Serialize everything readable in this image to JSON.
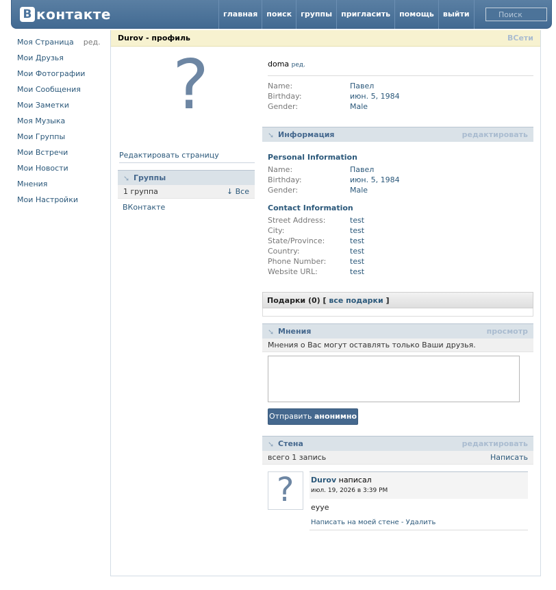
{
  "header": {
    "logo_letter": "В",
    "logo_text": "контакте",
    "nav": [
      "главная",
      "поиск",
      "группы",
      "пригласить",
      "помощь",
      "выйти"
    ],
    "search_placeholder": "Поиск"
  },
  "sidebar": {
    "items": [
      {
        "label": "Моя Страница",
        "extra": "ред."
      },
      {
        "label": "Мои Друзья"
      },
      {
        "label": "Мои Фотографии"
      },
      {
        "label": "Мои Сообщения"
      },
      {
        "label": "Мои Заметки"
      },
      {
        "label": "Моя Музыка"
      },
      {
        "label": "Мои Группы"
      },
      {
        "label": "Мои Встречи"
      },
      {
        "label": "Мои Новости"
      },
      {
        "label": "Мнения"
      },
      {
        "label": "Мои Настройки"
      }
    ]
  },
  "profile": {
    "title": "Durov - профиль",
    "all_link": "ВСети",
    "avatar_placeholder": "?",
    "edit_page": "Редактировать страницу",
    "status_text": "doma",
    "status_edit": "ред.",
    "basic": [
      {
        "k": "Name:",
        "v": "Павел"
      },
      {
        "k": "Birthday:",
        "v": "июн. 5, 1984"
      },
      {
        "k": "Gender:",
        "v": "Male"
      }
    ]
  },
  "groups": {
    "header": "Группы",
    "count": "1 группа",
    "all": "↓ Все",
    "items": [
      "ВКонтакте"
    ]
  },
  "info": {
    "header": "Информация",
    "edit": "редактировать",
    "personal_title": "Personal Information",
    "personal": [
      {
        "k": "Name:",
        "v": "Павел"
      },
      {
        "k": "Birthday:",
        "v": "июн. 5, 1984"
      },
      {
        "k": "Gender:",
        "v": "Male"
      }
    ],
    "contact_title": "Contact Information",
    "contact": [
      {
        "k": "Street Address:",
        "v": "test"
      },
      {
        "k": "City:",
        "v": "test"
      },
      {
        "k": "State/Province:",
        "v": "test"
      },
      {
        "k": "Country:",
        "v": "test"
      },
      {
        "k": "Phone Number:",
        "v": "test"
      },
      {
        "k": "Website URL:",
        "v": "test"
      }
    ]
  },
  "gifts": {
    "label": "Подарки (0)",
    "bracket_open": "[",
    "link": "все подарки",
    "bracket_close": "]"
  },
  "opinions": {
    "header": "Мнения",
    "view": "просмотр",
    "note": "Мнения о Вас могут оставлять только Ваши друзья.",
    "textarea_value": "",
    "button_text": "Отправить",
    "button_bold": "анонимно"
  },
  "wall": {
    "header": "Стена",
    "edit": "редактировать",
    "count": "всего 1 запись",
    "write": "Написать",
    "post": {
      "avatar": "?",
      "author": "Durov",
      "verb": "написал",
      "date": "июл. 19, 2026 в 3:39 PM",
      "text": "eyye",
      "actions": "Написать на моей стене - Удалить"
    }
  }
}
